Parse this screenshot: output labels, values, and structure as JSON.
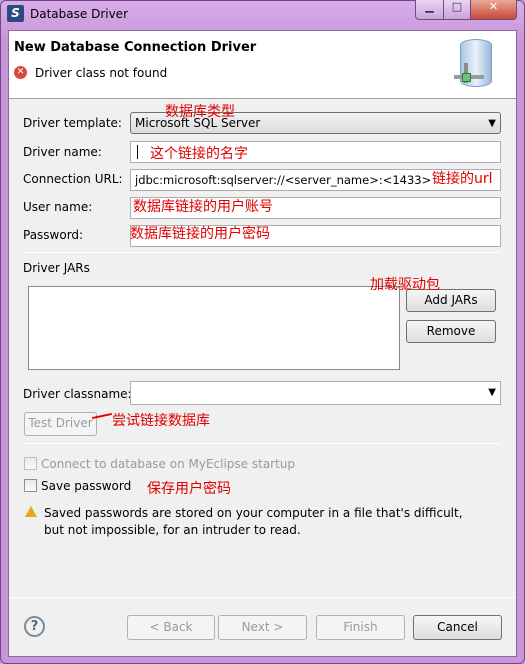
{
  "window": {
    "title": "Database Driver",
    "minimize": "▁",
    "maximize": "□",
    "close": "✕"
  },
  "header": {
    "title": "New Database Connection Driver",
    "message": "Driver class not found"
  },
  "form": {
    "template_label": "Driver template:",
    "template_value": "Microsoft SQL Server",
    "name_label": "Driver name:",
    "name_value": "",
    "url_label": "Connection URL:",
    "url_value": "jdbc:microsoft:sqlserver://<server_name>:<1433>",
    "user_label": "User name:",
    "user_value": "",
    "password_label": "Password:",
    "password_value": "",
    "jars_label": "Driver JARs",
    "add_jars": "Add JARs",
    "remove": "Remove",
    "classname_label": "Driver classname:",
    "classname_value": "",
    "test_driver": "Test Driver",
    "connect_startup": "Connect to database on MyEclipse startup",
    "save_password": "Save password",
    "warning": "Saved passwords are stored on your computer in a file that's difficult, but not impossible, for an intruder to read."
  },
  "annotations": {
    "template": "数据库类型",
    "name": "这个链接的名字",
    "url": "链接的url",
    "user": "数据库链接的用户账号",
    "password": "数据库链接的用户密码",
    "jars": "加载驱动包",
    "test": "尝试链接数据库",
    "save": "保存用户密码"
  },
  "footer": {
    "help": "?",
    "back": "< Back",
    "next": "Next >",
    "finish": "Finish",
    "cancel": "Cancel"
  }
}
